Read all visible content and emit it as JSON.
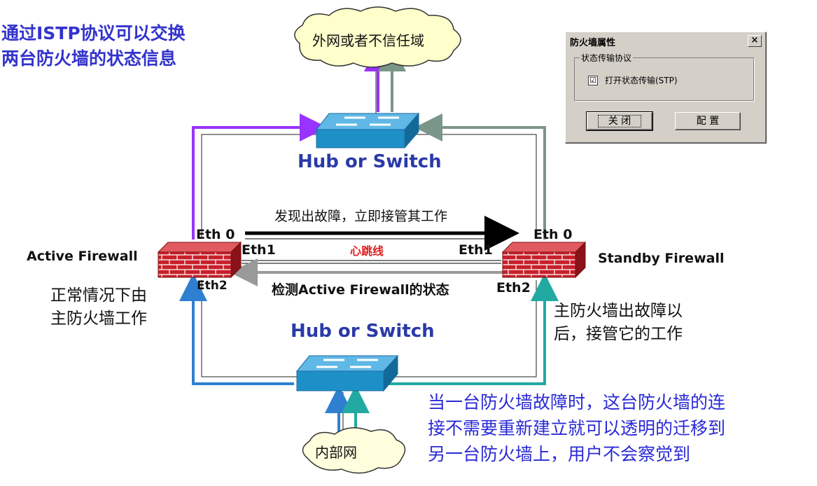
{
  "top_left_title": [
    "通过ISTP协议可以交换",
    "两台防火墙的状态信息"
  ],
  "cloud_top": "外网或者不信任域",
  "cloud_bottom": "内部网",
  "hub_top": "Hub or Switch",
  "hub_bottom": "Hub or Switch",
  "active_firewall": "Active Firewall",
  "standby_firewall": "Standby  Firewall",
  "eth": {
    "left_eth0": "Eth 0",
    "right_eth0": "Eth 0",
    "left_eth1": "Eth1",
    "right_eth1": "Eth1",
    "left_eth2": "Eth2",
    "right_eth2": "Eth2"
  },
  "takeover_text": "发现出故障，立即接管其工作",
  "heartbeat_text": "心跳线",
  "detect_text": "检测Active Firewall的状态",
  "left_caption": [
    "正常情况下由",
    "主防火墙工作"
  ],
  "right_caption": [
    "主防火墙出故障以",
    "后，接管它的工作"
  ],
  "bottom_note": [
    "当一台防火墙故障时，这台防火墙的连",
    "接不需要重新建立就可以透明的迁移到",
    "另一台防火墙上，用户不会察觉到"
  ],
  "dialog": {
    "title": "防火墙属性",
    "close_symbol": "×",
    "group_label": "状态传输协议",
    "checkbox_label": "打开状态传输(STP)",
    "checkbox_checked": "☑",
    "close_button": "关  闭",
    "config_button": "配 置"
  },
  "colors": {
    "purple": "#9933ff",
    "gray_green": "#7a9688",
    "blue": "#2f7fd0",
    "teal": "#22aaa2",
    "firewall_red": "#c8202a",
    "switch_blue": "#1e90c8"
  }
}
